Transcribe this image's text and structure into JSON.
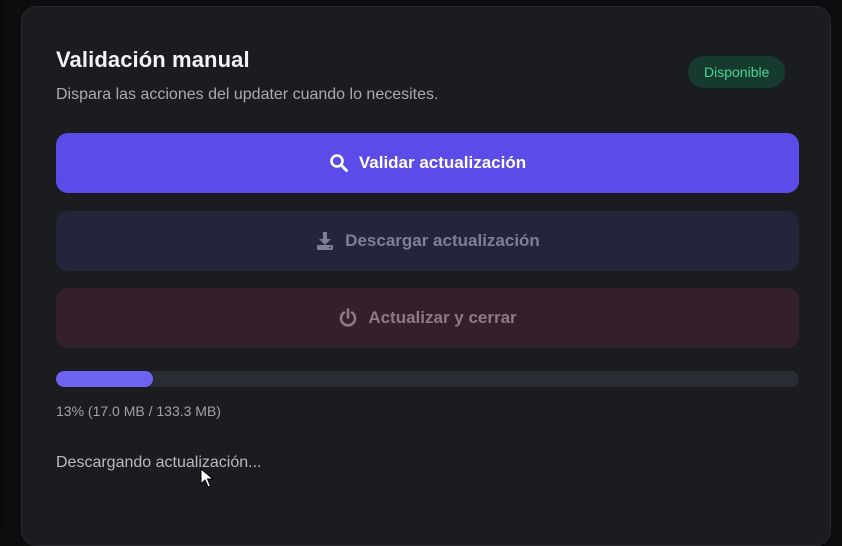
{
  "panel": {
    "title": "Validación manual",
    "subtitle": "Dispara las acciones del updater cuando lo necesites.",
    "badge": "Disponible"
  },
  "buttons": {
    "validate": {
      "label": "Validar actualización",
      "icon": "search-icon",
      "state": "enabled"
    },
    "download": {
      "label": "Descargar actualización",
      "icon": "download-icon",
      "state": "disabled"
    },
    "restart": {
      "label": "Actualizar y cerrar",
      "icon": "power-icon",
      "state": "disabled"
    }
  },
  "progress": {
    "percent": 13,
    "text": "13% (17.0 MB / 133.3 MB)"
  },
  "status": {
    "text": "Descargando actualización..."
  },
  "colors": {
    "background": "#0d0d0f",
    "card": "#1b1c20",
    "accent": "#5b4ce9",
    "badge_text": "#48d597",
    "badge_bg": "#163b2e"
  }
}
